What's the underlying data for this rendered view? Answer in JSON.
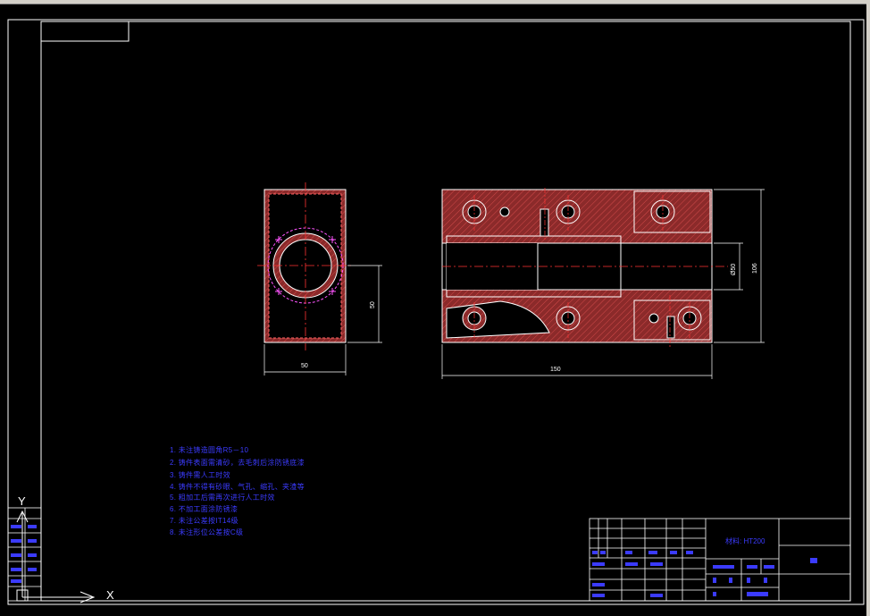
{
  "notes": {
    "items": [
      "1. 未注铸造圆角R5－10",
      "2. 铸件表面需清砂，去毛刺后涂防锈底漆",
      "3. 铸件需人工时效",
      "4. 铸件不得有砂眼、气孔、缩孔、夹渣等",
      "5. 粗加工后需再次进行人工时效",
      "6. 不加工面涂防锈漆",
      "7. 未注公差按IT14级",
      "8. 未注形位公差按C级"
    ]
  },
  "dimensions": {
    "front_width": "50",
    "front_height": "50",
    "side_length": "150",
    "side_height": "106",
    "side_bore": "Ø50"
  },
  "title_block": {
    "material": "材料: HT200"
  },
  "axes": {
    "y_label": "Y",
    "x_label": "X"
  },
  "colors": {
    "section_fill": "#8b2a2a",
    "outline": "#ffffff",
    "centerline": "#ff3333",
    "dimension": "#ffffff",
    "annotation": "#3b3bff",
    "frame": "#ffffff"
  }
}
